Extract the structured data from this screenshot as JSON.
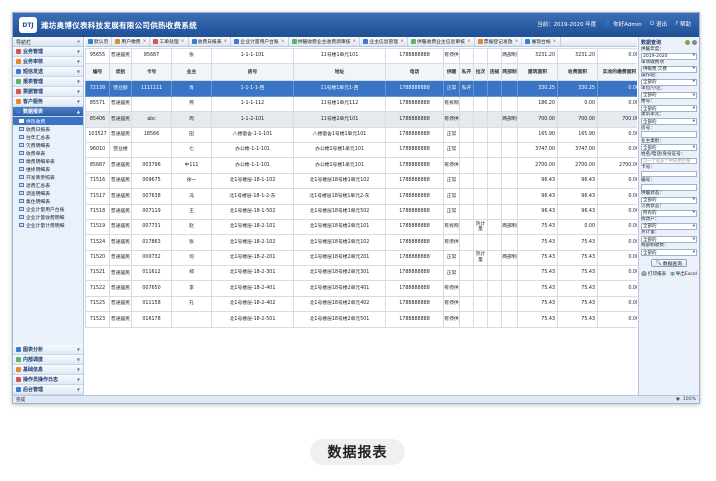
{
  "app": {
    "logo": "DTJ",
    "title": "潍坊奥博仪表科技发展有限公司供热收费系统"
  },
  "titlebar": {
    "season": "当前：2019-2020 年度",
    "user": "你好Admin",
    "exit": "退出",
    "help": "帮助"
  },
  "sidebar": {
    "title": "导航栏",
    "groups_top": [
      {
        "label": "业务管理",
        "color": "#d9534f"
      },
      {
        "label": "业务审核",
        "color": "#e08b2a"
      },
      {
        "label": "短信发送",
        "color": "#3a7bd5"
      },
      {
        "label": "报表管理",
        "color": "#5cb85c"
      },
      {
        "label": "票据管理",
        "color": "#d9534f"
      },
      {
        "label": "客户服务",
        "color": "#e08b2a"
      },
      {
        "label": "数据报表",
        "color": "#3a7bd5"
      }
    ],
    "items": [
      "供热收费",
      "收费日报表",
      "往年汇总表",
      "欠费明细表",
      "收费单表",
      "缴费明细单表",
      "维修明细表",
      "开发商参照表",
      "退费汇总表",
      "调查明细表",
      "集住明细表",
      "企业计量用户台账",
      "企业计量收费明细",
      "企业计量计费明细"
    ],
    "groups_bottom": [
      {
        "label": "图表分析",
        "color": "#3a7bd5"
      },
      {
        "label": "内部调度",
        "color": "#5cb85c"
      },
      {
        "label": "基础信息",
        "color": "#e08b2a"
      },
      {
        "label": "操作员操作日志",
        "color": "#d9534f"
      },
      {
        "label": "后台管理",
        "color": "#3a7bd5"
      }
    ]
  },
  "toolbar": {
    "tabs": [
      {
        "label": "默认页",
        "color": "#3a7bd5"
      },
      {
        "label": "用户缴费",
        "color": "#e08b2a"
      },
      {
        "label": "工单处理",
        "color": "#d9534f"
      },
      {
        "label": "收费日报表",
        "color": "#3a7bd5"
      },
      {
        "label": "企业计量用户台账",
        "color": "#3a7bd5"
      },
      {
        "label": "供暖收费业主收费调审核",
        "color": "#5cb85c"
      },
      {
        "label": "业主信息管理",
        "color": "#3a7bd5"
      },
      {
        "label": "供暖收费业主信息审核",
        "color": "#5cb85c"
      },
      {
        "label": "票据登记发放",
        "color": "#e08b2a"
      },
      {
        "label": "展现台帐",
        "color": "#3a7bd5"
      }
    ],
    "close_mark": "×"
  },
  "table": {
    "columns": [
      "编号",
      "类别",
      "卡号",
      "业主",
      "房号",
      "地址",
      "电话",
      "供暖",
      "私开",
      "拉次",
      "违规",
      "两部制",
      "建筑面积",
      "收费面积",
      "实收的缴费面积"
    ],
    "first_row": [
      "95655",
      "普通居民",
      "85687",
      "张",
      "1-1-1-101",
      "11号楼1单元101",
      "1788888888",
      "有停供",
      "",
      "",
      "",
      "两部制",
      "3231.20",
      "3231.20",
      "0.00"
    ],
    "rows": [
      {
        "cells": [
          "72139",
          "营业额",
          "1111111",
          "肖",
          "1-1-1-1-西",
          "11号楼1单元1-西",
          "1788888888",
          "正常",
          "私开",
          "",
          "",
          "",
          "330.25",
          "330.25",
          "0.00"
        ],
        "state": "sel"
      },
      {
        "cells": [
          "85571",
          "普通居民",
          "",
          "燕",
          "1-1-1-112",
          "11号楼1单元112",
          "1788888888",
          "有拆网",
          "",
          "",
          "",
          "",
          "186.20",
          "0.00",
          "0.00"
        ],
        "state": ""
      },
      {
        "cells": [
          "85406",
          "普通居民",
          "abc",
          "周",
          "1-1-2-101",
          "11号楼2单元101",
          "1788888888",
          "有停供",
          "",
          "",
          "",
          "两部制",
          "700.00",
          "700.00",
          "700.00"
        ],
        "state": "gray"
      },
      {
        "cells": [
          "103527",
          "普通居民",
          "18566",
          "田",
          "八楼宿舍-1-1-101",
          "八楼宿舍1号楼1单元101",
          "1788888888",
          "正常",
          "",
          "",
          "",
          "",
          "165.90",
          "165.90",
          "0.00"
        ],
        "state": ""
      },
      {
        "cells": [
          "96010",
          "营业楼",
          "",
          "七",
          "办公楼-1-1-101",
          "办公楼1号楼1单元101",
          "1788888888",
          "正常",
          "",
          "",
          "",
          "",
          "3747.00",
          "3747.00",
          "0.00"
        ],
        "state": ""
      },
      {
        "cells": [
          "85687",
          "普通居民",
          "003796",
          "中111",
          "办公楼-1-1-101",
          "办公楼1号楼1单元101",
          "1788888888",
          "有停供",
          "",
          "",
          "",
          "",
          "2700.00",
          "2700.00",
          "2700.00"
        ],
        "state": ""
      },
      {
        "cells": [
          "71516",
          "普通居民",
          "009675",
          "徐一",
          "北1号楼层-18-1-102",
          "北1号楼层18号楼1单元102",
          "1788888888",
          "正常",
          "",
          "",
          "",
          "",
          "96.43",
          "96.43",
          "0.00"
        ],
        "state": ""
      },
      {
        "cells": [
          "71517",
          "普通居民",
          "007638",
          "冯",
          "北1号楼层-18-1-2-东",
          "北1号楼层18号楼1单元2-东",
          "1788888888",
          "正常",
          "",
          "",
          "",
          "",
          "96.43",
          "96.43",
          "0.00"
        ],
        "state": ""
      },
      {
        "cells": [
          "71518",
          "普通居民",
          "007119",
          "王",
          "北1号楼层-18-1-502",
          "北1号楼层18号楼1单元502",
          "1788888888",
          "正常",
          "",
          "",
          "",
          "",
          "96.43",
          "96.43",
          "0.00"
        ],
        "state": ""
      },
      {
        "cells": [
          "71519",
          "普通居民",
          "007731",
          "赵",
          "北1号楼层-18-2-101",
          "北1号楼层18号楼2单元101",
          "1788888888",
          "有拆网",
          "",
          "热计量",
          "",
          "两部制",
          "75.43",
          "0.00",
          "0.00"
        ],
        "state": ""
      },
      {
        "cells": [
          "71524",
          "普通居民",
          "017863",
          "张",
          "北1号楼层-18-2-102",
          "北1号楼层18号楼2单元102",
          "1788888888",
          "有停供",
          "",
          "",
          "",
          "",
          "75.43",
          "75.43",
          "0.00"
        ],
        "state": ""
      },
      {
        "cells": [
          "71520",
          "普通居民",
          "000732",
          "何",
          "北1号楼层-18-2-201",
          "北1号楼层18号楼2单元201",
          "1788888888",
          "正常",
          "",
          "热计量",
          "",
          "两部制",
          "75.43",
          "75.43",
          "0.00"
        ],
        "state": ""
      },
      {
        "cells": [
          "71521",
          "普通居民",
          "011612",
          "郑",
          "北1号楼层-18-2-301",
          "北1号楼层18号楼2单元301",
          "1788888888",
          "正常",
          "",
          "",
          "",
          "",
          "75.43",
          "75.43",
          "0.00"
        ],
        "state": ""
      },
      {
        "cells": [
          "71522",
          "普通居民",
          "007650",
          "李",
          "北1号楼层-18-2-401",
          "北1号楼层18号楼2单元401",
          "1788888888",
          "有停供",
          "",
          "",
          "",
          "",
          "75.43",
          "75.43",
          "0.00"
        ],
        "state": ""
      },
      {
        "cells": [
          "71525",
          "普通居民",
          "011158",
          "孔",
          "北1号楼层-18-2-402",
          "北1号楼层18号楼2单元402",
          "1788888888",
          "有停供",
          "",
          "",
          "",
          "",
          "75.43",
          "75.43",
          "0.00"
        ],
        "state": ""
      },
      {
        "cells": [
          "71523",
          "普通居民",
          "016178",
          "",
          "北1号楼层-18-2-501",
          "北1号楼层18号楼2单元501",
          "1788888888",
          "有停供",
          "",
          "",
          "",
          "",
          "75.43",
          "75.43",
          "0.00"
        ],
        "state": ""
      }
    ]
  },
  "right_panel": {
    "title": "数据查询",
    "fields": [
      {
        "label": "供暖年度：",
        "type": "select",
        "value": "2019-2020"
      },
      {
        "label": "单项收费项",
        "type": "select",
        "value": "供暖费,欠费"
      },
      {
        "label": "操作站：",
        "type": "select",
        "value": "全部的"
      },
      {
        "label": "单位/小区：",
        "type": "select",
        "value": "全部的"
      },
      {
        "label": "楼号：",
        "type": "select",
        "value": "全部的"
      },
      {
        "label": "建筑单元：",
        "type": "select",
        "value": "全部的"
      },
      {
        "label": "房号：",
        "type": "input",
        "value": ""
      },
      {
        "label": "业主类别：",
        "type": "select",
        "value": "全部的"
      },
      {
        "label": "姓名/电话/身份证号：",
        "type": "input",
        "value": "可一个或多个中间用空格"
      },
      {
        "label": "卡号：",
        "type": "input",
        "value": ""
      },
      {
        "label": "编号：",
        "type": "input",
        "value": ""
      },
      {
        "label": "供暖状态：",
        "type": "select",
        "value": "全部的"
      },
      {
        "label": "欠费状态：",
        "type": "select",
        "value": "所有的"
      },
      {
        "label": "拆改户：",
        "type": "select",
        "value": "全部的"
      },
      {
        "label": "热计量：",
        "type": "select",
        "value": "全部的"
      },
      {
        "label": "两部制收费：",
        "type": "select",
        "value": "全部的"
      }
    ],
    "query_button": "数据查询",
    "print_label": "打印报表",
    "export_label": "导出Excel"
  },
  "statusbar": {
    "text": "完成",
    "zoom": "100%"
  },
  "caption": "数据报表"
}
